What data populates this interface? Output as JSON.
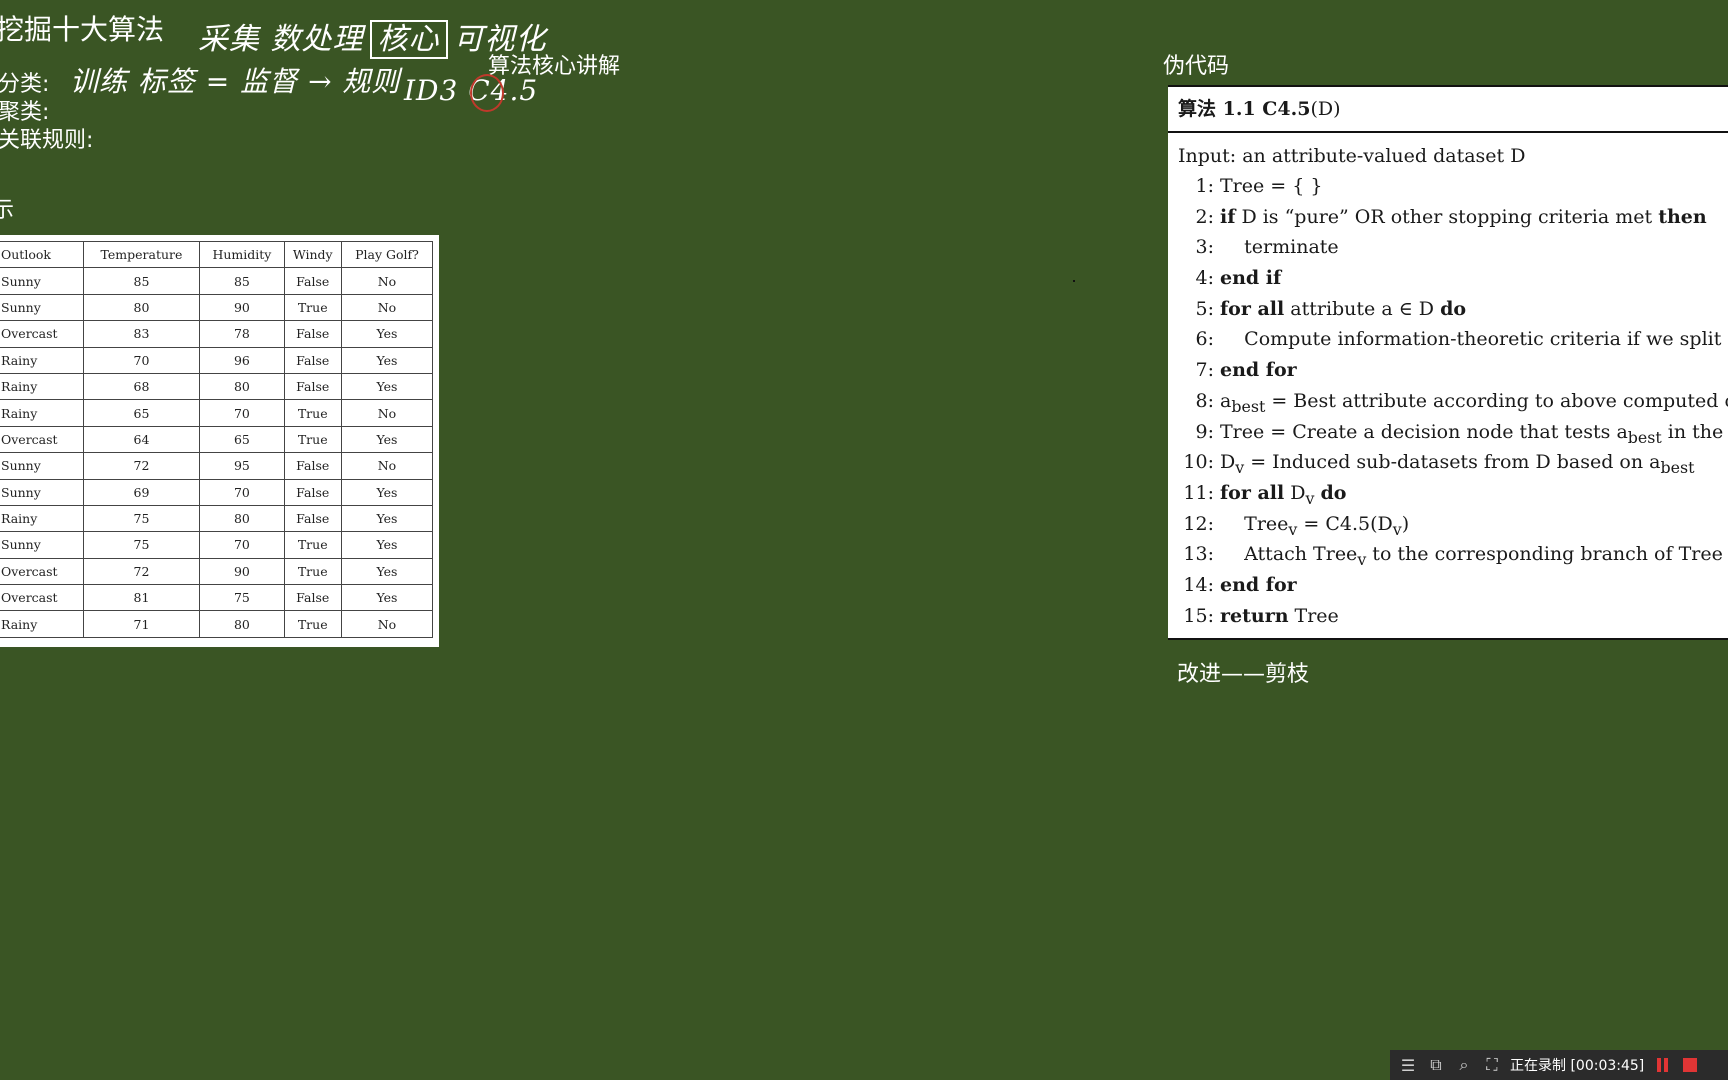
{
  "board": {
    "title": "挖掘十大算法",
    "section_title": "算法核心讲解",
    "labels": {
      "classify": "分类:",
      "cluster": "聚类:",
      "association": "关联规则:",
      "example": "示"
    },
    "handwriting": {
      "steps_a": "采集 数处理",
      "steps_boxed": "核心",
      "steps_b": "可视化",
      "classify_note": "训练 标签 = 监督 → 规则",
      "algo_note": "ID3 C4.5"
    }
  },
  "golf_table": {
    "headers": [
      "Outlook",
      "Temperature",
      "Humidity",
      "Windy",
      "Play Golf?"
    ],
    "rows": [
      [
        "Sunny",
        "85",
        "85",
        "False",
        "No"
      ],
      [
        "Sunny",
        "80",
        "90",
        "True",
        "No"
      ],
      [
        "Overcast",
        "83",
        "78",
        "False",
        "Yes"
      ],
      [
        "Rainy",
        "70",
        "96",
        "False",
        "Yes"
      ],
      [
        "Rainy",
        "68",
        "80",
        "False",
        "Yes"
      ],
      [
        "Rainy",
        "65",
        "70",
        "True",
        "No"
      ],
      [
        "Overcast",
        "64",
        "65",
        "True",
        "Yes"
      ],
      [
        "Sunny",
        "72",
        "95",
        "False",
        "No"
      ],
      [
        "Sunny",
        "69",
        "70",
        "False",
        "Yes"
      ],
      [
        "Rainy",
        "75",
        "80",
        "False",
        "Yes"
      ],
      [
        "Sunny",
        "75",
        "70",
        "True",
        "Yes"
      ],
      [
        "Overcast",
        "72",
        "90",
        "True",
        "Yes"
      ],
      [
        "Overcast",
        "81",
        "75",
        "False",
        "Yes"
      ],
      [
        "Rainy",
        "71",
        "80",
        "True",
        "No"
      ]
    ]
  },
  "pseudocode": {
    "label": "伪代码",
    "header_prefix": "算法 1.1   C4.5",
    "header_arg": "(D)",
    "input": "Input: an attribute-valued dataset D",
    "lines": [
      {
        "num": "1:",
        "html": "Tree = { }"
      },
      {
        "num": "2:",
        "html": "<span class='kw'>if</span> D is “pure” OR other stopping criteria met <span class='kw'>then</span>"
      },
      {
        "num": "3:",
        "html": "&nbsp;&nbsp;&nbsp;&nbsp;terminate"
      },
      {
        "num": "4:",
        "html": "<span class='kw'>end if</span>"
      },
      {
        "num": "5:",
        "html": "<span class='kw'>for all</span> attribute a ∈ D <span class='kw'>do</span>"
      },
      {
        "num": "6:",
        "html": "&nbsp;&nbsp;&nbsp;&nbsp;Compute information-theoretic criteria if we split on a"
      },
      {
        "num": "7:",
        "html": "<span class='kw'>end for</span>"
      },
      {
        "num": "8:",
        "html": "a<sub>best</sub> = Best attribute according to above computed criteria"
      },
      {
        "num": "9:",
        "html": "Tree = Create a decision node that tests a<sub>best</sub> in the root"
      },
      {
        "num": "10:",
        "html": "D<sub>v</sub> = Induced sub-datasets from D based on a<sub>best</sub>"
      },
      {
        "num": "11:",
        "html": "<span class='kw'>for all</span> D<sub>v</sub> <span class='kw'>do</span>"
      },
      {
        "num": "12:",
        "html": "&nbsp;&nbsp;&nbsp;&nbsp;Tree<sub>v</sub> = C4.5(D<sub>v</sub>)"
      },
      {
        "num": "13:",
        "html": "&nbsp;&nbsp;&nbsp;&nbsp;Attach Tree<sub>v</sub> to the corresponding branch of Tree"
      },
      {
        "num": "14:",
        "html": "<span class='kw'>end for</span>"
      },
      {
        "num": "15:",
        "html": "<span class='kw'>return</span> Tree"
      }
    ],
    "improvement_label": "改进——剪枝"
  },
  "recording_bar": {
    "status": "正在录制 [00:03:45]",
    "icons": [
      "menu-icon",
      "window-icon",
      "zoom-region-icon",
      "crop-icon",
      "pause-icon",
      "stop-icon"
    ]
  },
  "colors": {
    "board_background": "#3a5524",
    "record_accent": "#e03535"
  }
}
